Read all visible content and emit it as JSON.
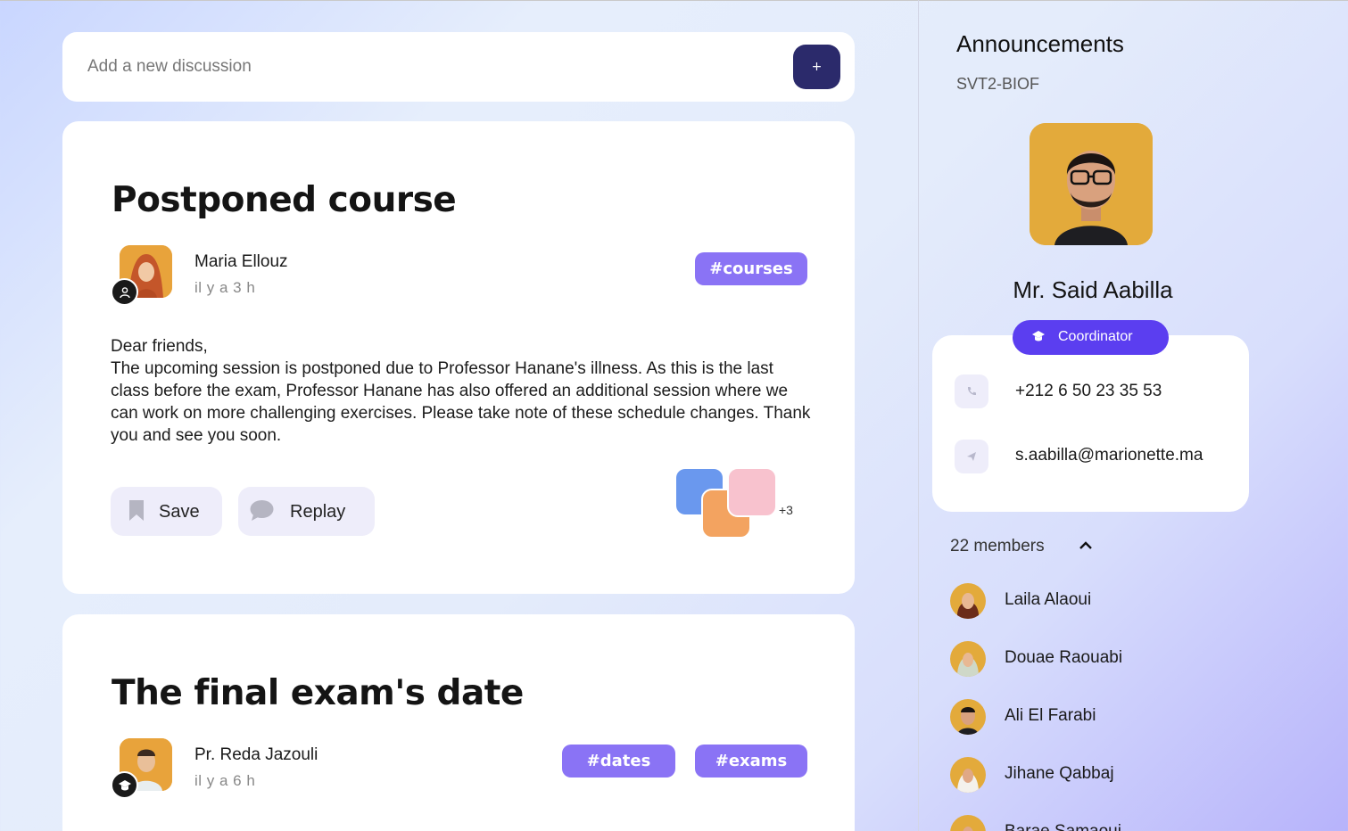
{
  "composer": {
    "placeholder": "Add a new discussion",
    "add_label": "+"
  },
  "posts": [
    {
      "title": "Postponed course",
      "author": "Maria Ellouz",
      "time": "il y a 3 h",
      "tags": [
        "#courses"
      ],
      "body": "Dear friends,\nThe upcoming session is postponed due to Professor Hanane's illness. As this is the last class before the exam, Professor Hanane has also offered an additional session where we can work on more challenging exercises. Please take note of these schedule changes. Thank you and see you soon.",
      "save_label": "Save",
      "reply_label": "Replay",
      "extra_participants": "+3"
    },
    {
      "title": "The final exam's date",
      "author": "Pr. Reda Jazouli",
      "time": "il y a 6 h",
      "tags": [
        "#dates",
        "#exams"
      ]
    }
  ],
  "sidebar": {
    "title": "Announcements",
    "group": "SVT2-BIOF",
    "coordinator": {
      "name": "Mr. Said Aabilla",
      "role": "Coordinator",
      "phone": "+212 6 50 23 35 53",
      "email": "s.aabilla@marionette.ma"
    },
    "members_label": "22 members",
    "members": [
      "Laila Alaoui",
      "Douae Raouabi",
      "Ali El Farabi",
      "Jihane Qabbaj",
      "Barae Samaoui"
    ]
  },
  "colors": {
    "accent": "#8a73f5",
    "badge": "#5b3ef0",
    "primary_btn": "#2b2a6b"
  }
}
